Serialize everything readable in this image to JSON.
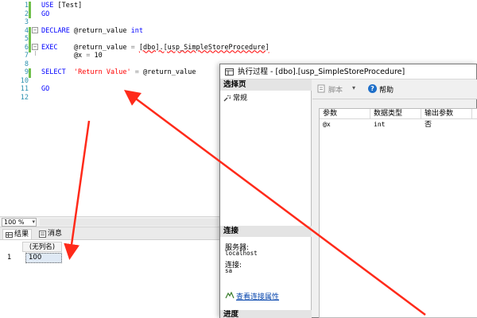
{
  "editor": {
    "line_numbers": [
      "1",
      "2",
      "3",
      "4",
      "5",
      "6",
      "7",
      "8",
      "9",
      "10",
      "11",
      "12"
    ],
    "lines": [
      [
        {
          "t": "USE ",
          "c": "kw"
        },
        {
          "t": "[Test]",
          "c": "plain"
        }
      ],
      [
        {
          "t": "GO",
          "c": "kw"
        }
      ],
      [],
      [
        {
          "t": "DECLARE ",
          "c": "kw"
        },
        {
          "t": "@return_value ",
          "c": "plain"
        },
        {
          "t": "int",
          "c": "kw"
        }
      ],
      [],
      [
        {
          "t": "EXEC    ",
          "c": "kw"
        },
        {
          "t": "@return_value ",
          "c": "plain"
        },
        {
          "t": "= ",
          "c": "gray"
        },
        {
          "t": "[dbo].[usp_SimpleStoreProcedure]",
          "c": "obj"
        }
      ],
      [
        {
          "t": "        @x ",
          "c": "plain"
        },
        {
          "t": "= ",
          "c": "gray"
        },
        {
          "t": "10",
          "c": "plain"
        }
      ],
      [],
      [
        {
          "t": "SELECT  ",
          "c": "kw"
        },
        {
          "t": "'Return Value'",
          "c": "str"
        },
        {
          "t": " = ",
          "c": "gray"
        },
        {
          "t": "@return_value",
          "c": "plain"
        }
      ],
      [],
      [
        {
          "t": "GO",
          "c": "kw"
        }
      ],
      []
    ]
  },
  "zoom": {
    "value": "100 %"
  },
  "results": {
    "tab_results": "结果",
    "tab_messages": "消息",
    "column_header": "(无列名)",
    "row_number": "1",
    "cell_value": "100"
  },
  "dialog": {
    "title": "执行过程 - [dbo].[usp_SimpleStoreProcedure]",
    "select_page_header": "选择页",
    "page_general": "常规",
    "connection_header": "连接",
    "server_label": "服务器:",
    "server_value": "localhost",
    "connection_label": "连接:",
    "connection_value": "sa",
    "view_connection_link": "查看连接属性",
    "progress_header": "进度",
    "toolbar": {
      "script_label": "脚本",
      "help_label": "帮助"
    },
    "params": {
      "headers": [
        "参数",
        "数据类型",
        "输出参数"
      ],
      "rows": [
        {
          "name": "@x",
          "type": "int",
          "output": "否"
        }
      ]
    }
  },
  "colors": {
    "keyword": "#0000ff",
    "string": "#ff0000",
    "arrow": "#ff2a1a",
    "link": "#0645ad"
  }
}
